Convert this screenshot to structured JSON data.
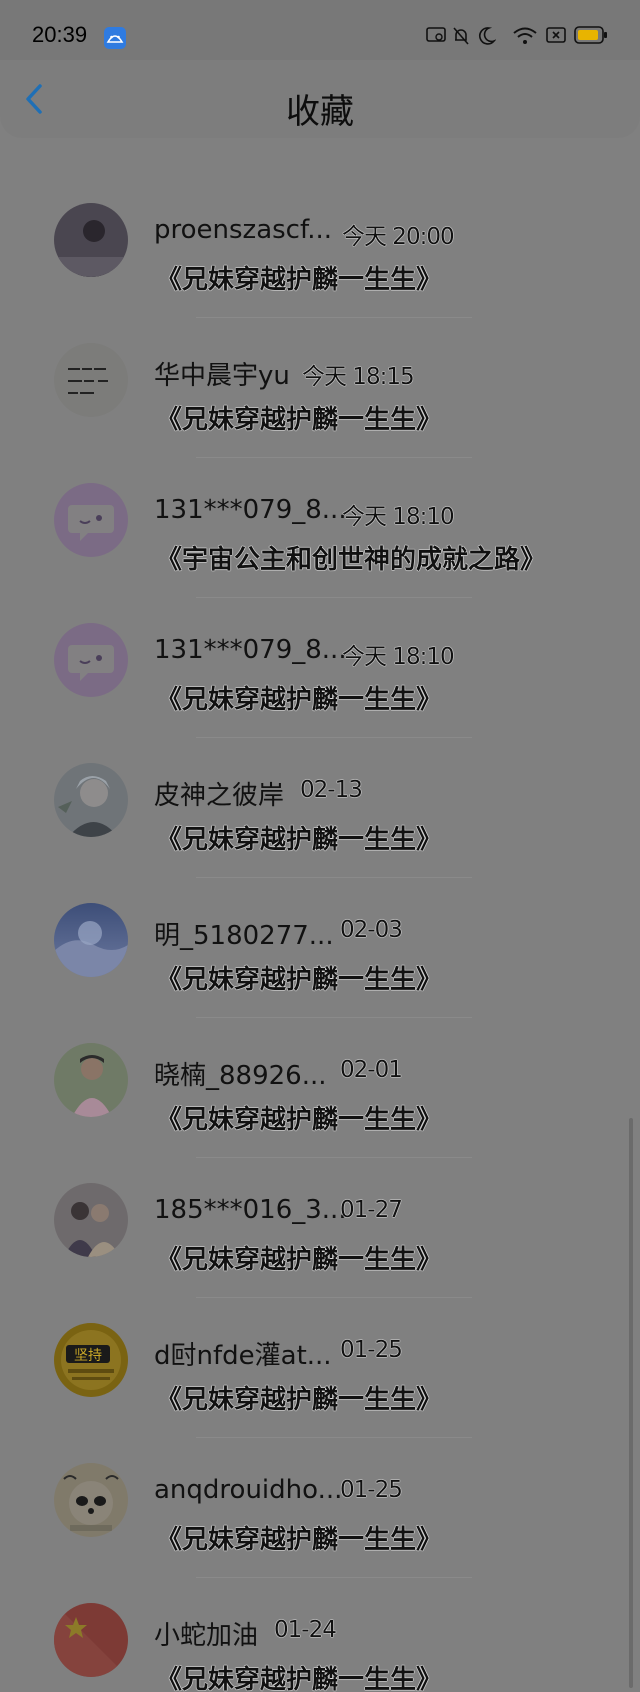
{
  "status_bar": {
    "time": "20:39"
  },
  "header": {
    "title": "收藏"
  },
  "items": [
    {
      "name": "proenszascf...",
      "time": "今天 20:00",
      "title": "《兄妹穿越护麟一生生》",
      "avatar": "avatar-photo-dark"
    },
    {
      "name": "华中晨宇yu",
      "time": "今天 18:15",
      "title": "《兄妹穿越护麟一生生》",
      "avatar": "avatar-handwriting"
    },
    {
      "name": "131***079_8...",
      "time": "今天 18:10",
      "title": "《宇宙公主和创世神的成就之路》",
      "avatar": "avatar-chat-bubble"
    },
    {
      "name": "131***079_8...",
      "time": "今天 18:10",
      "title": "《兄妹穿越护麟一生生》",
      "avatar": "avatar-chat-bubble"
    },
    {
      "name": "皮神之彼岸",
      "time": "02-13",
      "title": "《兄妹穿越护麟一生生》",
      "avatar": "avatar-anime-character"
    },
    {
      "name": "明_5180277...",
      "time": "02-03",
      "title": "《兄妹穿越护麟一生生》",
      "avatar": "avatar-sky"
    },
    {
      "name": "晓楠_88926...",
      "time": "02-01",
      "title": "《兄妹穿越护麟一生生》",
      "avatar": "avatar-person-photo"
    },
    {
      "name": "185***016_3...",
      "time": "01-27",
      "title": "《兄妹穿越护麟一生生》",
      "avatar": "avatar-group-photo"
    },
    {
      "name": "d尀nfde灌at...",
      "time": "01-25",
      "title": "《兄妹穿越护麟一生生》",
      "avatar": "avatar-text-badge"
    },
    {
      "name": "anqdrouidho...",
      "time": "01-25",
      "title": "《兄妹穿越护麟一生生》",
      "avatar": "avatar-panda"
    },
    {
      "name": "小蛇加油",
      "time": "01-24",
      "title": "《兄妹穿越护麟一生生》",
      "avatar": "avatar-flag"
    }
  ],
  "avatar_badge_text": "坚持"
}
